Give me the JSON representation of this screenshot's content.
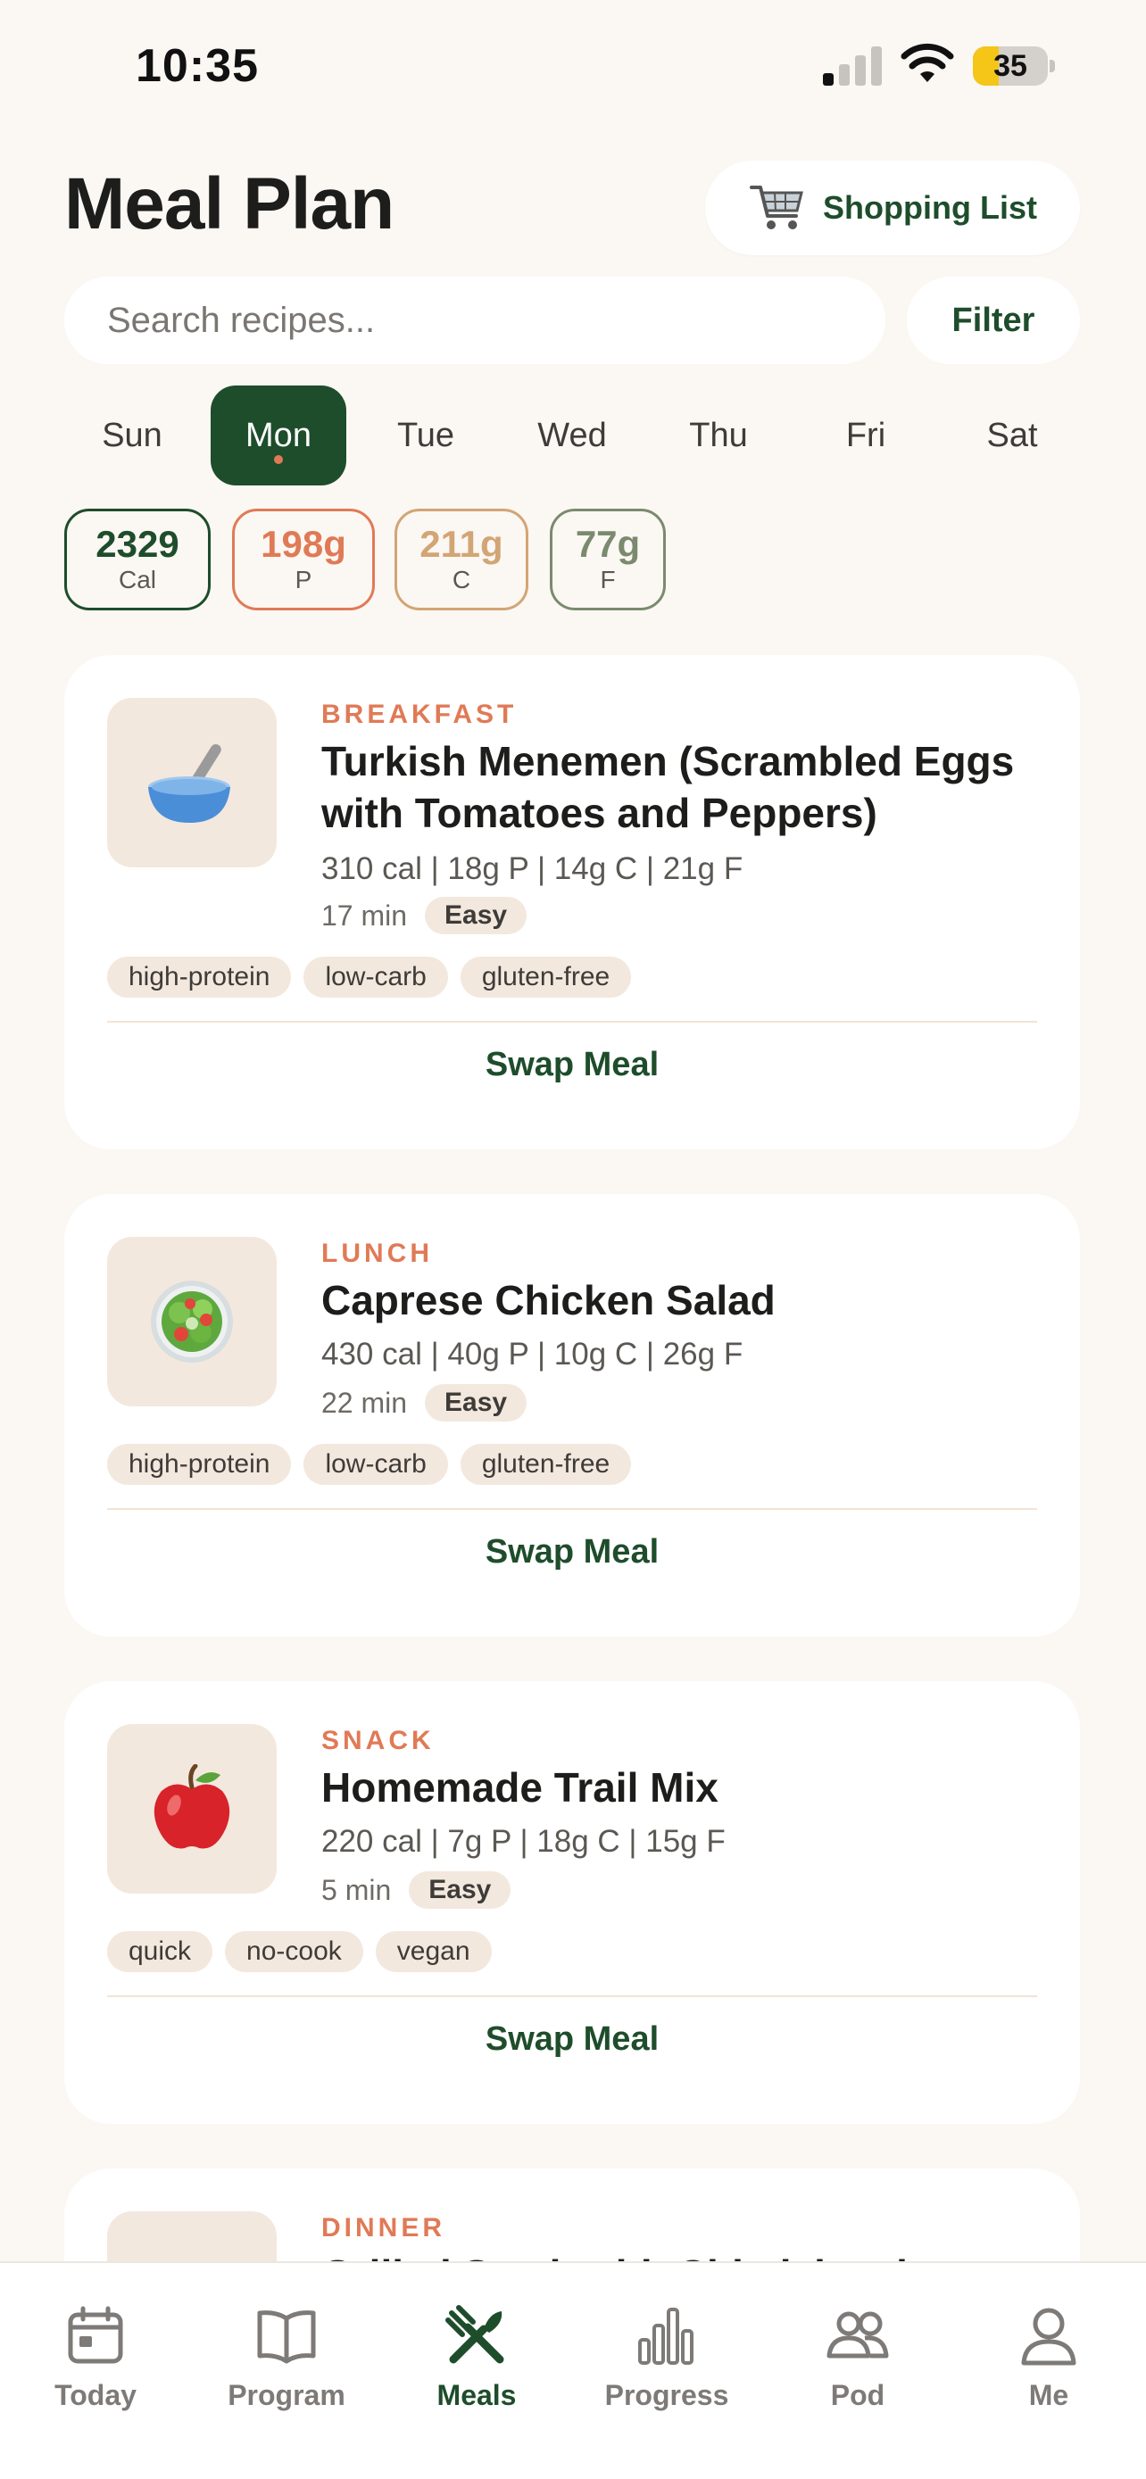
{
  "status_bar": {
    "time": "10:35",
    "battery": "35"
  },
  "header": {
    "title": "Meal Plan",
    "shopping_label": "Shopping List"
  },
  "search": {
    "placeholder": "Search recipes...",
    "filter_label": "Filter"
  },
  "days": [
    "Sun",
    "Mon",
    "Tue",
    "Wed",
    "Thu",
    "Fri",
    "Sat"
  ],
  "selected_day": "Mon",
  "macros": [
    {
      "value": "2329",
      "unit": "Cal",
      "color": "#1e4d2b"
    },
    {
      "value": "198g",
      "unit": "P",
      "color": "#e07a56"
    },
    {
      "value": "211g",
      "unit": "C",
      "color": "#d2a575"
    },
    {
      "value": "77g",
      "unit": "F",
      "color": "#7b8a6f"
    }
  ],
  "meals": [
    {
      "type": "BREAKFAST",
      "title": "Turkish Menemen (Scrambled Eggs with Tomatoes and Peppers)",
      "nutrition": "310 cal | 18g P | 14g C | 21g F",
      "time": "17 min",
      "difficulty": "Easy",
      "tags": [
        "high-protein",
        "low-carb",
        "gluten-free"
      ],
      "icon": "bowl-icon",
      "swap_label": "Swap Meal"
    },
    {
      "type": "LUNCH",
      "title": "Caprese Chicken Salad",
      "nutrition": "430 cal | 40g P | 10g C | 26g F",
      "time": "22 min",
      "difficulty": "Easy",
      "tags": [
        "high-protein",
        "low-carb",
        "gluten-free"
      ],
      "icon": "salad-icon",
      "swap_label": "Swap Meal"
    },
    {
      "type": "SNACK",
      "title": "Homemade Trail Mix",
      "nutrition": "220 cal | 7g P | 18g C | 15g F",
      "time": "5 min",
      "difficulty": "Easy",
      "tags": [
        "quick",
        "no-cook",
        "vegan"
      ],
      "icon": "apple-icon",
      "swap_label": "Swap Meal"
    },
    {
      "type": "DINNER",
      "title": "Grilled Steak with Chimichurri",
      "icon": "dinner-icon"
    }
  ],
  "tabs": [
    {
      "label": "Today",
      "icon": "calendar-icon"
    },
    {
      "label": "Program",
      "icon": "book-icon"
    },
    {
      "label": "Meals",
      "icon": "utensils-icon",
      "active": true
    },
    {
      "label": "Progress",
      "icon": "bar-chart-icon"
    },
    {
      "label": "Pod",
      "icon": "people-icon"
    },
    {
      "label": "Me",
      "icon": "person-icon"
    }
  ],
  "colors": {
    "accent": "#1e4d2b",
    "meal_type": "#e07a56",
    "background": "#fbf7f3"
  }
}
